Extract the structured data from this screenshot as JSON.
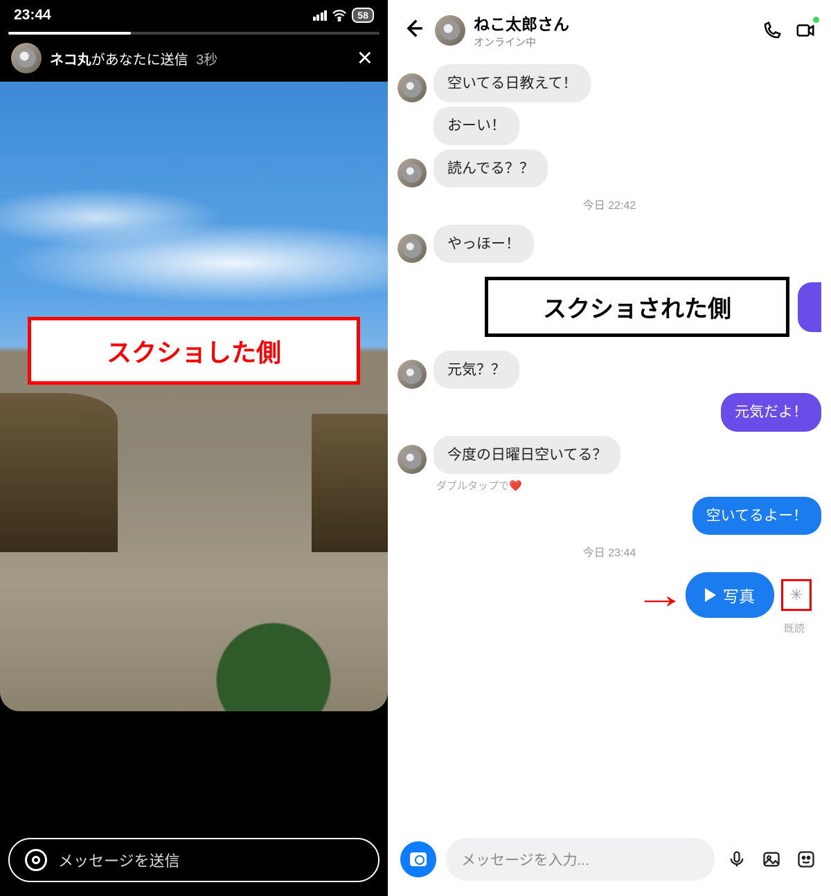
{
  "left": {
    "status_time": "23:44",
    "battery": "58",
    "story_sender": "ネコ丸",
    "story_sent_suffix": "があなたに送信",
    "story_time": "3秒",
    "caption": "スクショした側",
    "input_placeholder": "メッセージを送信"
  },
  "right": {
    "chat_name": "ねこ太郎さん",
    "chat_status": "オンライン中",
    "messages": [
      {
        "side": "recv",
        "text": "空いてる日教えて！",
        "avatar": true
      },
      {
        "side": "recv",
        "text": "おーい！",
        "avatar": false
      },
      {
        "side": "recv",
        "text": "読んでる？？",
        "avatar": true
      }
    ],
    "timestamp1": "今日 22:42",
    "msg4": "やっほー！",
    "callout": "スクショされた側",
    "msg5": "元気？？",
    "msg6": "元気だよ！",
    "msg7": "今度の日曜日空いてる？",
    "hint": "ダブルタップで❤️",
    "msg8": "空いてるよー！",
    "timestamp2": "今日 23:44",
    "photo_label": "写真",
    "read_status": "既読",
    "input_placeholder": "メッセージを入力...",
    "camera_icon": "camera",
    "mic_icon": "mic",
    "image_icon": "image",
    "sticker_icon": "sticker"
  }
}
